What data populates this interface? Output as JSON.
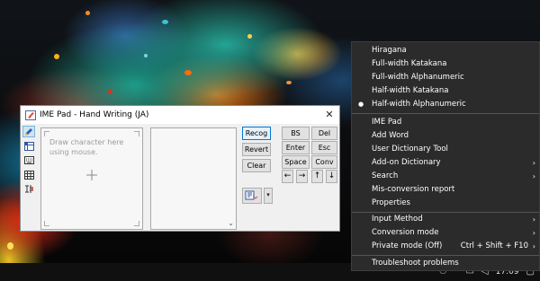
{
  "ime_pad": {
    "title": "IME Pad - Hand Writing (JA)",
    "draw_hint": "Draw character here using mouse.",
    "buttons": {
      "recog": "Recog",
      "revert": "Revert",
      "clear": "Clear",
      "bs": "BS",
      "del": "Del",
      "enter": "Enter",
      "esc": "Esc",
      "space": "Space",
      "conv": "Conv",
      "left": "←",
      "right": "→",
      "up": "↑",
      "down": "↓"
    },
    "icons": [
      "pen-icon",
      "grid-icon",
      "keyboard-icon",
      "table-icon",
      "radical-icon"
    ]
  },
  "menu": {
    "input_modes": [
      "Hiragana",
      "Full-width Katakana",
      "Full-width Alphanumeric",
      "Half-width Katakana",
      "Half-width Alphanumeric"
    ],
    "selected_mode": "Half-width Alphanumeric",
    "tools": [
      "IME Pad",
      "Add Word",
      "User Dictionary Tool",
      "Add-on Dictionary",
      "Search",
      "Mis-conversion report",
      "Properties"
    ],
    "settings": [
      "Input Method",
      "Conversion mode",
      "Private mode (Off)"
    ],
    "private_mode_shortcut": "Ctrl + Shift + F10",
    "troubleshoot": "Troubleshoot problems"
  },
  "taskbar": {
    "clock": "17:09"
  },
  "colors": {
    "menu_bg": "#2b2b2b",
    "accent": "#0078d7"
  }
}
